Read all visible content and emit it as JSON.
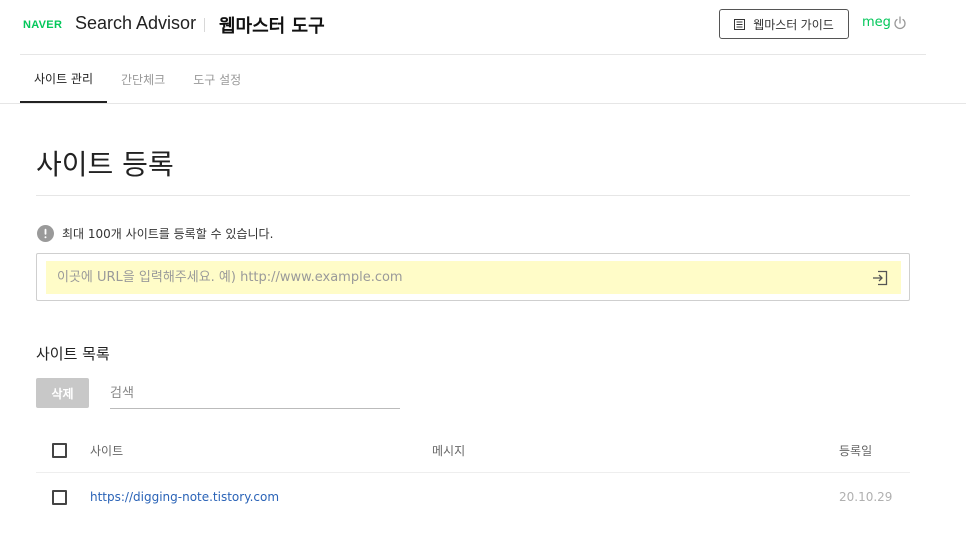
{
  "header": {
    "naver_logo": "NAVER",
    "product_name": "Search Advisor",
    "tool_name": "웹마스터 도구",
    "guide_button_label": "웹마스터 가이드",
    "user_name": "meg"
  },
  "tabs": [
    {
      "label": "사이트 관리",
      "active": true
    },
    {
      "label": "간단체크",
      "active": false
    },
    {
      "label": "도구 설정",
      "active": false
    }
  ],
  "main": {
    "page_title": "사이트 등록",
    "notice": "최대 100개 사이트를 등록할 수 있습니다.",
    "url_input": {
      "value": "",
      "placeholder": "이곳에 URL을 입력해주세요. 예) http://www.example.com"
    },
    "list_title": "사이트 목록",
    "delete_button_label": "삭제",
    "search": {
      "value": "",
      "placeholder": "검색"
    },
    "table": {
      "columns": [
        "사이트",
        "메시지",
        "등록일"
      ],
      "rows": [
        {
          "site": "https://digging-note.tistory.com",
          "message": "",
          "date": "20.10.29"
        }
      ]
    }
  },
  "colors": {
    "brand_green": "#03c75a",
    "input_highlight": "#fffcc8",
    "link_blue": "#2a63b7"
  },
  "icons": [
    "guide-document-icon",
    "power-icon",
    "info-icon",
    "enter-arrow-icon"
  ]
}
